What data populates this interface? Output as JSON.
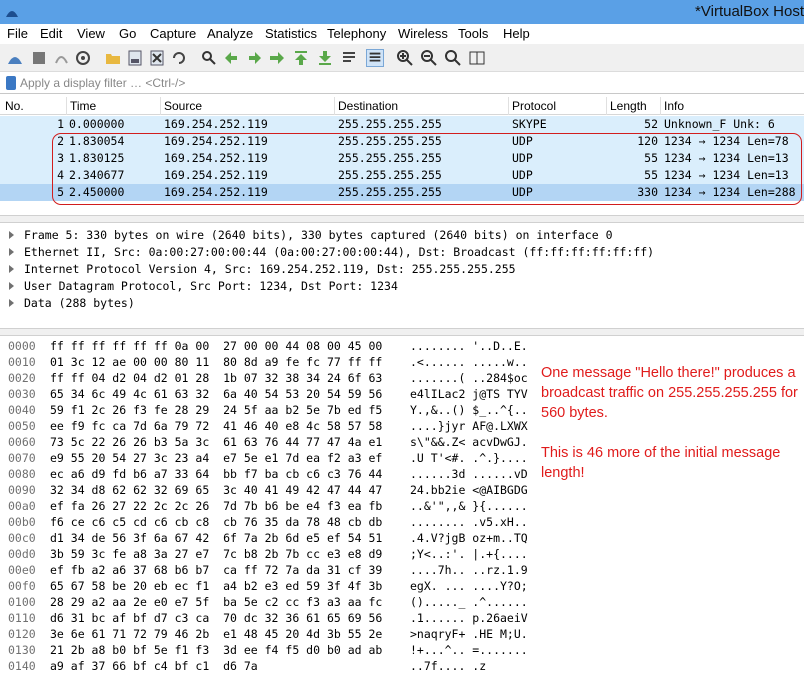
{
  "window": {
    "title": "*VirtualBox Host"
  },
  "menu": [
    "File",
    "Edit",
    "View",
    "Go",
    "Capture",
    "Analyze",
    "Statistics",
    "Telephony",
    "Wireless",
    "Tools",
    "Help"
  ],
  "toolbar": {
    "icons": [
      "shark-fin-start-icon",
      "stop-capture-icon",
      "restart-capture-icon",
      "capture-options-icon",
      "open-file-icon",
      "save-file-icon",
      "close-file-icon",
      "reload-icon",
      "find-packet-icon",
      "go-back-icon",
      "go-forward-icon",
      "go-to-packet-icon",
      "go-first-icon",
      "go-last-icon",
      "autoscroll-icon",
      "colorize-icon",
      "zoom-in-icon",
      "zoom-out-icon",
      "zoom-normal-icon",
      "resize-columns-icon"
    ]
  },
  "filter": {
    "placeholder": "Apply a display filter … <Ctrl-/>"
  },
  "columns": [
    "No.",
    "Time",
    "Source",
    "Destination",
    "Protocol",
    "Length",
    "Info"
  ],
  "packets": [
    {
      "no": "1",
      "time": "0.000000",
      "src": "169.254.252.119",
      "dst": "255.255.255.255",
      "proto": "SKYPE",
      "len": "52",
      "info": "Unknown_F Unk: 6"
    },
    {
      "no": "2",
      "time": "1.830054",
      "src": "169.254.252.119",
      "dst": "255.255.255.255",
      "proto": "UDP",
      "len": "120",
      "info": "1234 → 1234 Len=78"
    },
    {
      "no": "3",
      "time": "1.830125",
      "src": "169.254.252.119",
      "dst": "255.255.255.255",
      "proto": "UDP",
      "len": "55",
      "info": "1234 → 1234 Len=13"
    },
    {
      "no": "4",
      "time": "2.340677",
      "src": "169.254.252.119",
      "dst": "255.255.255.255",
      "proto": "UDP",
      "len": "55",
      "info": "1234 → 1234 Len=13"
    },
    {
      "no": "5",
      "time": "2.450000",
      "src": "169.254.252.119",
      "dst": "255.255.255.255",
      "proto": "UDP",
      "len": "330",
      "info": "1234 → 1234 Len=288"
    }
  ],
  "details": [
    "Frame 5: 330 bytes on wire (2640 bits), 330 bytes captured (2640 bits) on interface 0",
    "Ethernet II, Src: 0a:00:27:00:00:44 (0a:00:27:00:00:44), Dst: Broadcast (ff:ff:ff:ff:ff:ff)",
    "Internet Protocol Version 4, Src: 169.254.252.119, Dst: 255.255.255.255",
    "User Datagram Protocol, Src Port: 1234, Dst Port: 1234",
    "Data (288 bytes)"
  ],
  "hex": [
    {
      "off": "0000",
      "bytes": "ff ff ff ff ff ff 0a 00  27 00 00 44 08 00 45 00",
      "ascii": "........ '..D..E."
    },
    {
      "off": "0010",
      "bytes": "01 3c 12 ae 00 00 80 11  80 8d a9 fe fc 77 ff ff",
      "ascii": ".<...... .....w.."
    },
    {
      "off": "0020",
      "bytes": "ff ff 04 d2 04 d2 01 28  1b 07 32 38 34 24 6f 63",
      "ascii": ".......( ..284$oc"
    },
    {
      "off": "0030",
      "bytes": "65 34 6c 49 4c 61 63 32  6a 40 54 53 20 54 59 56",
      "ascii": "e4lILac2 j@TS TYV"
    },
    {
      "off": "0040",
      "bytes": "59 f1 2c 26 f3 fe 28 29  24 5f aa b2 5e 7b ed f5",
      "ascii": "Y.,&..() $_..^{.."
    },
    {
      "off": "0050",
      "bytes": "ee f9 fc ca 7d 6a 79 72  41 46 40 e8 4c 58 57 58",
      "ascii": "....}jyr AF@.LXWX"
    },
    {
      "off": "0060",
      "bytes": "73 5c 22 26 26 b3 5a 3c  61 63 76 44 77 47 4a e1",
      "ascii": "s\\\"&&.Z< acvDwGJ."
    },
    {
      "off": "0070",
      "bytes": "e9 55 20 54 27 3c 23 a4  e7 5e e1 7d ea f2 a3 ef",
      "ascii": ".U T'<#. .^.}...."
    },
    {
      "off": "0080",
      "bytes": "ec a6 d9 fd b6 a7 33 64  bb f7 ba cb c6 c3 76 44",
      "ascii": "......3d ......vD"
    },
    {
      "off": "0090",
      "bytes": "32 34 d8 62 62 32 69 65  3c 40 41 49 42 47 44 47",
      "ascii": "24.bb2ie <@AIBGDG"
    },
    {
      "off": "00a0",
      "bytes": "ef fa 26 27 22 2c 2c 26  7d 7b b6 be e4 f3 ea fb",
      "ascii": "..&'\",,& }{......"
    },
    {
      "off": "00b0",
      "bytes": "f6 ce c6 c5 cd c6 cb c8  cb 76 35 da 78 48 cb db",
      "ascii": "........ .v5.xH.."
    },
    {
      "off": "00c0",
      "bytes": "d1 34 de 56 3f 6a 67 42  6f 7a 2b 6d e5 ef 54 51",
      "ascii": ".4.V?jgB oz+m..TQ"
    },
    {
      "off": "00d0",
      "bytes": "3b 59 3c fe a8 3a 27 e7  7c b8 2b 7b cc e3 e8 d9",
      "ascii": ";Y<..:'. |.+{...."
    },
    {
      "off": "00e0",
      "bytes": "ef fb a2 a6 37 68 b6 b7  ca ff 72 7a da 31 cf 39",
      "ascii": "....7h.. ..rz.1.9"
    },
    {
      "off": "00f0",
      "bytes": "65 67 58 be 20 eb ec f1  a4 b2 e3 ed 59 3f 4f 3b",
      "ascii": "egX. ... ....Y?O;"
    },
    {
      "off": "0100",
      "bytes": "28 29 a2 aa 2e e0 e7 5f  ba 5e c2 cc f3 a3 aa fc",
      "ascii": "()....._ .^......"
    },
    {
      "off": "0110",
      "bytes": "d6 31 bc af bf d7 c3 ca  70 dc 32 36 61 65 69 56",
      "ascii": ".1...... p.26aeiV"
    },
    {
      "off": "0120",
      "bytes": "3e 6e 61 71 72 79 46 2b  e1 48 45 20 4d 3b 55 2e",
      "ascii": ">naqryF+ .HE M;U."
    },
    {
      "off": "0130",
      "bytes": "21 2b a8 b0 bf 5e f1 f3  3d ee f4 f5 d0 b0 ad ab",
      "ascii": "!+...^.. =......."
    },
    {
      "off": "0140",
      "bytes": "a9 af 37 66 bf c4 bf c1  d6 7a",
      "ascii": "..7f.... .z"
    }
  ],
  "annotation": {
    "line1": "One message \"Hello there!\" produces a broadcast traffic on 255.255.255.255 for 560 bytes.",
    "line2": "This is 46 more of the initial message length!"
  },
  "colors": {
    "rowBg": "#daeefc",
    "selectedRowBg": "#b3d5f4",
    "highlight": "#d21d1d",
    "titlebar": "#5aa0e6"
  }
}
